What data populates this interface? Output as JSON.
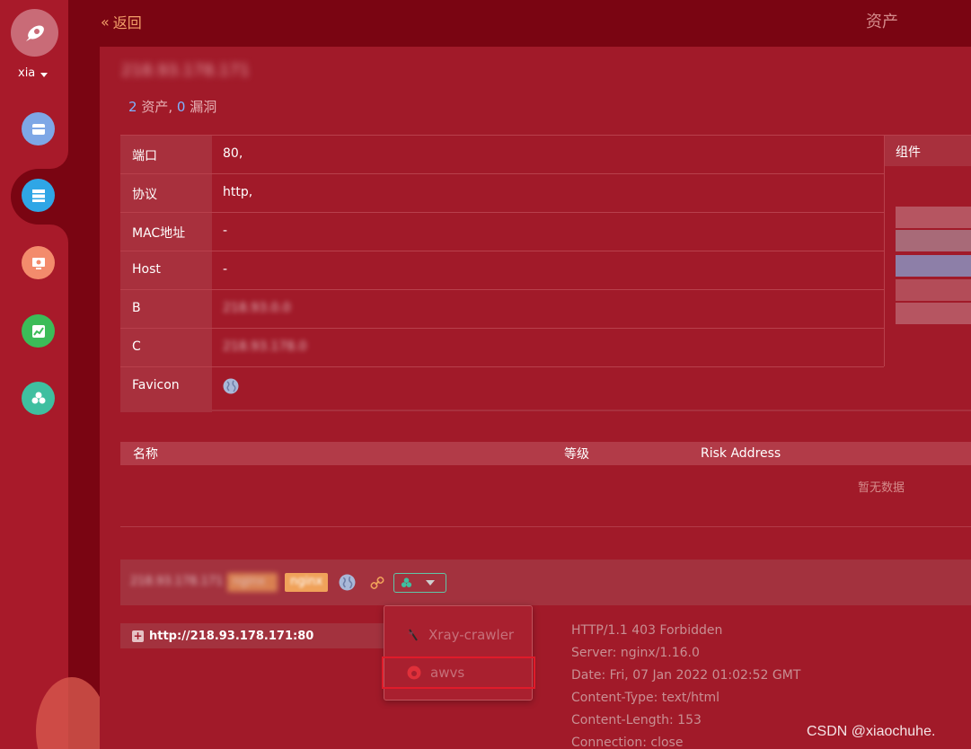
{
  "sidebar": {
    "username": "xia",
    "nav": [
      {
        "id": "assets-icon",
        "color": "#6aa0e8"
      },
      {
        "id": "server-icon",
        "color": "#3aa8e8"
      },
      {
        "id": "monitor-icon",
        "color": "#f28b6a"
      },
      {
        "id": "chart-icon",
        "color": "#3dbf5b"
      },
      {
        "id": "plugin-icon",
        "color": "#3fbfa0"
      }
    ]
  },
  "header": {
    "back_label": "返回",
    "page_title": "资产"
  },
  "target": {
    "ip_title": "218.93.178.171",
    "asset_count": "2",
    "asset_label": "资产,",
    "vuln_count": "0",
    "vuln_label": "漏洞"
  },
  "info": {
    "rows": [
      {
        "key": "端口",
        "value": "80,"
      },
      {
        "key": "协议",
        "value": "http,"
      },
      {
        "key": "MAC地址",
        "value": "-"
      },
      {
        "key": "Host",
        "value": "-"
      },
      {
        "key": "B",
        "value": "218.93.0.0"
      },
      {
        "key": "C",
        "value": "218.93.178.0"
      }
    ],
    "favicon_key": "Favicon",
    "components_header": "组件"
  },
  "vulns": {
    "columns": [
      "名称",
      "等级",
      "Risk Address"
    ],
    "empty_text": "暂无数据"
  },
  "asset": {
    "ip": "218.93.178.171",
    "tag1": "nginx",
    "tag2": "nginx",
    "url": "http://218.93.178.171:80"
  },
  "plugin_dropdown": {
    "items": [
      "Xray-crawler",
      "awvs"
    ]
  },
  "response_headers": [
    "HTTP/1.1 403 Forbidden",
    "Server: nginx/1.16.0",
    "Date: Fri, 07 Jan 2022 01:02:52 GMT",
    "Content-Type: text/html",
    "Content-Length: 153",
    "Connection: close"
  ],
  "watermark": "CSDN @xiaochuhe."
}
